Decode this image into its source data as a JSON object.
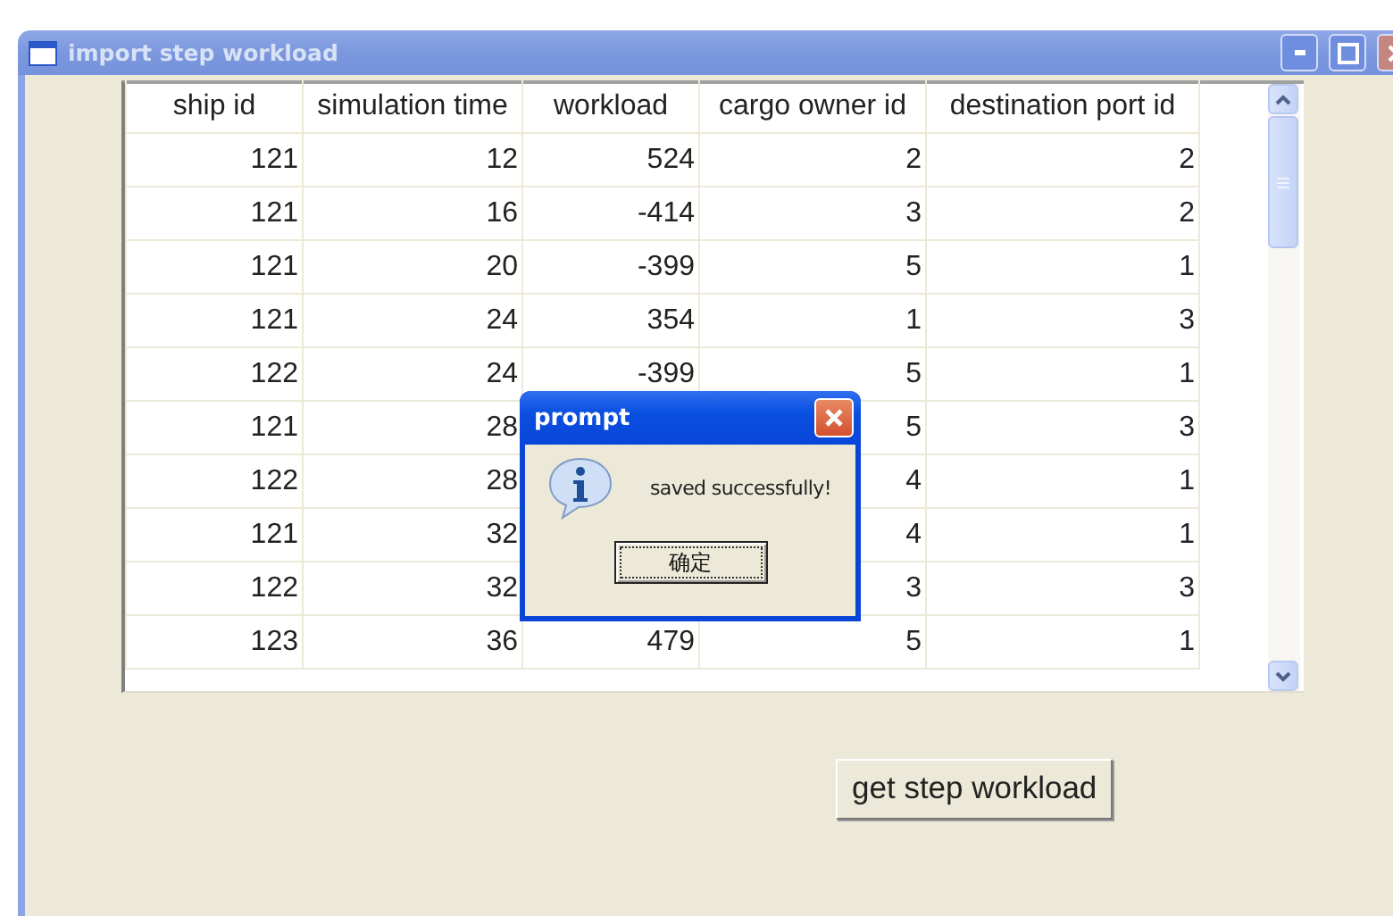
{
  "window": {
    "title": "import step workload"
  },
  "table": {
    "columns": [
      "ship id",
      "simulation time",
      "workload",
      "cargo owner id",
      "destination port id"
    ],
    "rows": [
      [
        "121",
        "12",
        "524",
        "2",
        "2"
      ],
      [
        "121",
        "16",
        "-414",
        "3",
        "2"
      ],
      [
        "121",
        "20",
        "-399",
        "5",
        "1"
      ],
      [
        "121",
        "24",
        "354",
        "1",
        "3"
      ],
      [
        "122",
        "24",
        "-399",
        "5",
        "1"
      ],
      [
        "121",
        "28",
        null,
        "5",
        "3"
      ],
      [
        "122",
        "28",
        null,
        "4",
        "1"
      ],
      [
        "121",
        "32",
        null,
        "4",
        "1"
      ],
      [
        "122",
        "32",
        null,
        "3",
        "3"
      ],
      [
        "123",
        "36",
        "479",
        "5",
        "1"
      ]
    ]
  },
  "button": {
    "label": "get step workload"
  },
  "dialog": {
    "title": "prompt",
    "message": "saved successfully!",
    "button": "确定"
  }
}
